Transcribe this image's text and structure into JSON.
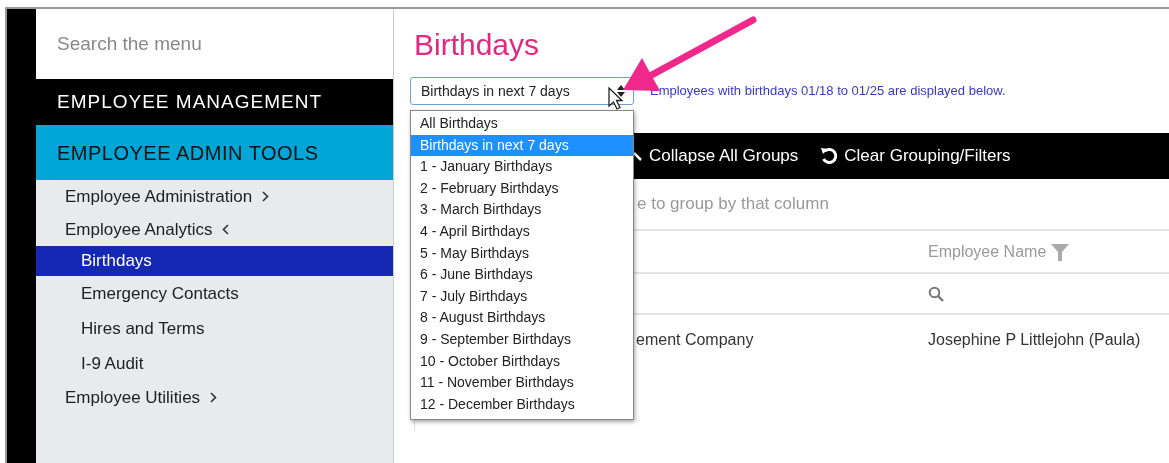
{
  "sidebar": {
    "search": {
      "placeholder": "Search the menu"
    },
    "section": "EMPLOYEE MANAGEMENT",
    "group": "EMPLOYEE ADMIN TOOLS",
    "items": [
      {
        "label": "Employee Administration",
        "expanded": false
      },
      {
        "label": "Employee Analytics",
        "expanded": true,
        "children": [
          {
            "label": "Birthdays",
            "selected": true
          },
          {
            "label": "Emergency Contacts",
            "selected": false
          },
          {
            "label": "Hires and Terms",
            "selected": false
          },
          {
            "label": "I-9 Audit",
            "selected": false
          }
        ]
      },
      {
        "label": "Employee Utilities",
        "expanded": false
      }
    ]
  },
  "page": {
    "title": "Birthdays"
  },
  "filter": {
    "value": "Birthdays in next 7 days",
    "expanded": true,
    "note": "Employees with birthdays 01/18 to 01/25 are displayed below.",
    "options": [
      {
        "label": "All Birthdays",
        "selected": false
      },
      {
        "label": "Birthdays in next 7 days",
        "selected": true
      },
      {
        "label": "1 - January Birthdays",
        "selected": false
      },
      {
        "label": "2 - February Birthdays",
        "selected": false
      },
      {
        "label": "3 - March Birthdays",
        "selected": false
      },
      {
        "label": "4 - April Birthdays",
        "selected": false
      },
      {
        "label": "5 - May Birthdays",
        "selected": false
      },
      {
        "label": "6 - June Birthdays",
        "selected": false
      },
      {
        "label": "7 - July Birthdays",
        "selected": false
      },
      {
        "label": "8 - August Birthdays",
        "selected": false
      },
      {
        "label": "9 - September Birthdays",
        "selected": false
      },
      {
        "label": "10 - October Birthdays",
        "selected": false
      },
      {
        "label": "11 - November Birthdays",
        "selected": false
      },
      {
        "label": "12 - December Birthdays",
        "selected": false
      }
    ]
  },
  "toolbar": {
    "buttons": [
      {
        "kind": "collapse",
        "label": "Collapse All Groups"
      },
      {
        "kind": "reset",
        "label": "Clear Grouping/Filters"
      }
    ]
  },
  "grid": {
    "group_hint": "e to group by that column",
    "employee_name_header": "Employee Name",
    "rows": [
      {
        "column_1": "ement Company",
        "employee_name": "Josephine P Littlejohn (Paula)"
      }
    ]
  }
}
